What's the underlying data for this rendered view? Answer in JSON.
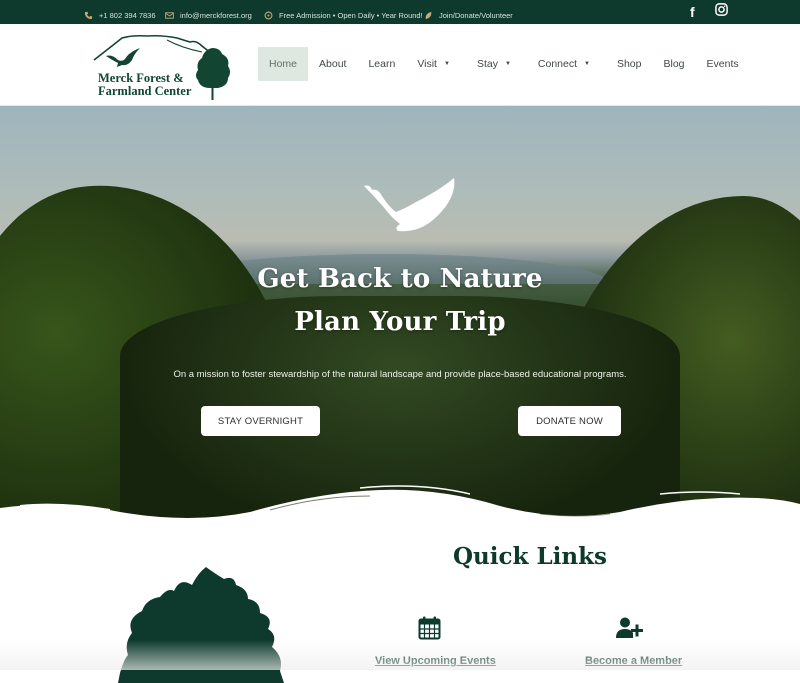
{
  "topbar": {
    "phone": "+1 802 394 7836",
    "email": "info@merckforest.org",
    "hours": "Free Admission • Open Daily • Year Round!",
    "join": "Join/Donate/Volunteer",
    "social": {
      "facebook": "f",
      "instagram": "◎"
    },
    "icons": {
      "phone": "phone-icon",
      "email": "envelope-icon",
      "hours": "clock-icon",
      "join": "leaf-icon"
    },
    "background": "#0d3a2c"
  },
  "logo": {
    "line1": "Merck Forest &",
    "line2": "Farmland Center"
  },
  "nav": {
    "items": [
      {
        "label": "Home",
        "active": true,
        "dropdown": false
      },
      {
        "label": "About",
        "dropdown": false
      },
      {
        "label": "Learn",
        "dropdown": false
      },
      {
        "label": "Visit",
        "dropdown": true
      },
      {
        "label": "Stay",
        "dropdown": true
      },
      {
        "label": "Connect",
        "dropdown": true
      },
      {
        "label": "Shop",
        "dropdown": false
      },
      {
        "label": "Blog",
        "dropdown": false
      },
      {
        "label": "Events",
        "dropdown": false
      }
    ],
    "caret": "▼"
  },
  "hero": {
    "title_line1": "Get Back to Nature",
    "title_line2": "Plan Your Trip",
    "subtitle": "On a mission to foster stewardship of  the natural landscape and provide place-based educational programs.",
    "buttons": {
      "stay": "STAY OVERNIGHT",
      "donate": "DONATE NOW"
    }
  },
  "quick_links": {
    "title": "Quick Links",
    "links": [
      {
        "label": "View Upcoming Events",
        "icon": "calendar-icon"
      },
      {
        "label": "Become a Member",
        "icon": "user-plus-icon"
      }
    ]
  },
  "colors": {
    "brand_green": "#0d3a2c",
    "nav_active_bg": "#dfe7e1",
    "button_bg": "#ffffff"
  }
}
